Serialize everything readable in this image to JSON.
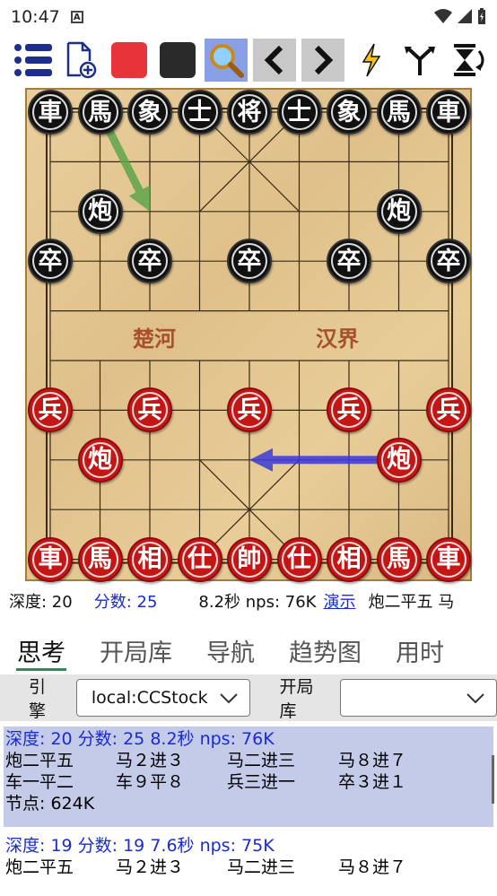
{
  "status_bar": {
    "time": "10:47",
    "notification_icon": "A"
  },
  "toolbar": {
    "icons": [
      "menu-icon",
      "new-file-icon",
      "red-square-icon",
      "black-square-icon",
      "search-icon",
      "chevron-left-icon",
      "chevron-right-icon",
      "lightning-icon",
      "branch-icon",
      "flip-icon"
    ]
  },
  "board": {
    "river_left": "楚河",
    "river_right": "汉界",
    "pieces": [
      {
        "side": "black",
        "label": "車",
        "col": 0,
        "row": 0
      },
      {
        "side": "black",
        "label": "馬",
        "col": 1,
        "row": 0
      },
      {
        "side": "black",
        "label": "象",
        "col": 2,
        "row": 0
      },
      {
        "side": "black",
        "label": "士",
        "col": 3,
        "row": 0
      },
      {
        "side": "black",
        "label": "将",
        "col": 4,
        "row": 0
      },
      {
        "side": "black",
        "label": "士",
        "col": 5,
        "row": 0
      },
      {
        "side": "black",
        "label": "象",
        "col": 6,
        "row": 0
      },
      {
        "side": "black",
        "label": "馬",
        "col": 7,
        "row": 0
      },
      {
        "side": "black",
        "label": "車",
        "col": 8,
        "row": 0
      },
      {
        "side": "black",
        "label": "炮",
        "col": 1,
        "row": 2
      },
      {
        "side": "black",
        "label": "炮",
        "col": 7,
        "row": 2
      },
      {
        "side": "black",
        "label": "卒",
        "col": 0,
        "row": 3
      },
      {
        "side": "black",
        "label": "卒",
        "col": 2,
        "row": 3
      },
      {
        "side": "black",
        "label": "卒",
        "col": 4,
        "row": 3
      },
      {
        "side": "black",
        "label": "卒",
        "col": 6,
        "row": 3
      },
      {
        "side": "black",
        "label": "卒",
        "col": 8,
        "row": 3
      },
      {
        "side": "red",
        "label": "兵",
        "col": 0,
        "row": 6
      },
      {
        "side": "red",
        "label": "兵",
        "col": 2,
        "row": 6
      },
      {
        "side": "red",
        "label": "兵",
        "col": 4,
        "row": 6
      },
      {
        "side": "red",
        "label": "兵",
        "col": 6,
        "row": 6
      },
      {
        "side": "red",
        "label": "兵",
        "col": 8,
        "row": 6
      },
      {
        "side": "red",
        "label": "炮",
        "col": 1,
        "row": 7
      },
      {
        "side": "red",
        "label": "炮",
        "col": 7,
        "row": 7
      },
      {
        "side": "red",
        "label": "車",
        "col": 0,
        "row": 9
      },
      {
        "side": "red",
        "label": "馬",
        "col": 1,
        "row": 9
      },
      {
        "side": "red",
        "label": "相",
        "col": 2,
        "row": 9
      },
      {
        "side": "red",
        "label": "仕",
        "col": 3,
        "row": 9
      },
      {
        "side": "red",
        "label": "帥",
        "col": 4,
        "row": 9
      },
      {
        "side": "red",
        "label": "仕",
        "col": 5,
        "row": 9
      },
      {
        "side": "red",
        "label": "相",
        "col": 6,
        "row": 9
      },
      {
        "side": "red",
        "label": "馬",
        "col": 7,
        "row": 9
      },
      {
        "side": "red",
        "label": "車",
        "col": 8,
        "row": 9
      }
    ],
    "arrows": [
      {
        "color": "green",
        "from": {
          "col": 1,
          "row": 0
        },
        "to": {
          "col": 2,
          "row": 2
        }
      },
      {
        "color": "blue",
        "from": {
          "col": 7,
          "row": 7
        },
        "to": {
          "col": 4,
          "row": 7
        }
      }
    ]
  },
  "info": {
    "depth": "深度: 20",
    "score": "分数: 25",
    "time_nps": "8.2秒  nps: 76K",
    "demo_link": "演示",
    "moves_preview": "炮二平五  马"
  },
  "tabs": [
    "思考",
    "开局库",
    "导航",
    "趋势图",
    "用时"
  ],
  "engine_bar": {
    "engine_label": "引擎",
    "engine_value": "local:CCStock",
    "book_label": "开局库",
    "book_value": ""
  },
  "results": [
    {
      "header": "深度: 20  分数: 25  8.2秒  nps: 76K",
      "moves": [
        "炮二平五",
        "马２进３",
        "马二进三",
        "马８进７",
        "车一平二",
        "车９平８",
        "兵三进一",
        "卒３进１"
      ],
      "nodes": "节点: 624K"
    },
    {
      "header": "深度: 19  分数: 19  7.6秒  nps: 75K",
      "moves": [
        "炮二平五",
        "马２进３",
        "马二进三",
        "马８进７"
      ]
    }
  ],
  "colors": {
    "accent": "#2f8a5b",
    "link": "#1a2bd1",
    "selected_tool": "#8aa0e6",
    "result_bg": "#c3cbe8"
  }
}
